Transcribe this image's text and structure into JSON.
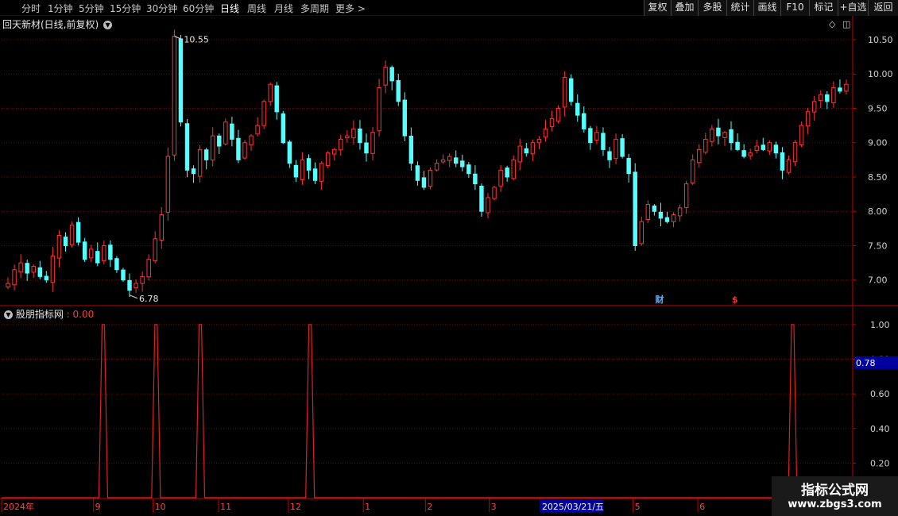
{
  "toolbar": {
    "periods": [
      "分时",
      "1分钟",
      "5分钟",
      "15分钟",
      "30分钟",
      "60分钟",
      "日线",
      "周线",
      "月线",
      "多周期",
      "更多 >"
    ],
    "active_period": "日线",
    "right_buttons": [
      "复权",
      "叠加",
      "多股",
      "统计",
      "画线",
      "F10",
      "标记",
      "+自选",
      "返回"
    ]
  },
  "main_chart": {
    "title": "回天新材(日线,前复权)",
    "high_label": "10.55",
    "low_label": "6.78",
    "markers": [
      {
        "text": "财",
        "color": "#5ab0ff"
      },
      {
        "text": "$",
        "color": "#ff3030"
      }
    ]
  },
  "indicator": {
    "name": "股朋指标网",
    "value": ": 0.00",
    "cursor_value": "0.78"
  },
  "date_axis": {
    "selected_date": "2025/03/21/五"
  },
  "watermark": {
    "title": "指标公式网",
    "url": "www.zbgs3.com"
  },
  "colors": {
    "up": "#ff3232",
    "down": "#54ffff",
    "grid": "#7a0000",
    "axis": "#c00000",
    "indicator_line": "#e02020",
    "highlight_bg": "#0000a0"
  },
  "chart_data": [
    {
      "type": "candlestick",
      "title": "回天新材(日线,前复权)",
      "ylim": [
        6.65,
        10.65
      ],
      "y_ticks": [
        "10.50",
        "10.00",
        "9.50",
        "9.00",
        "8.50",
        "8.00",
        "7.50",
        "7.00"
      ],
      "x_labels": [
        "2024年",
        "9",
        "10",
        "11",
        "12",
        "1",
        "2",
        "3",
        "2025/03/21/五",
        "5",
        "6"
      ],
      "close_path": [
        6.95,
        7.15,
        7.25,
        7.1,
        7.2,
        7.05,
        7.0,
        7.35,
        7.65,
        7.5,
        7.8,
        7.55,
        7.3,
        7.45,
        7.25,
        7.5,
        7.3,
        7.15,
        7.0,
        6.85,
        6.95,
        7.05,
        7.3,
        7.6,
        7.95,
        8.8,
        10.55,
        9.3,
        8.6,
        8.55,
        8.9,
        8.75,
        9.1,
        8.95,
        9.3,
        9.05,
        8.75,
        9.0,
        9.1,
        9.25,
        9.6,
        9.85,
        9.45,
        9.0,
        8.7,
        8.5,
        8.75,
        8.6,
        8.45,
        8.7,
        8.85,
        8.9,
        9.05,
        9.1,
        9.2,
        9.0,
        8.85,
        9.15,
        9.8,
        10.1,
        9.9,
        9.6,
        9.1,
        8.7,
        8.45,
        8.35,
        8.6,
        8.7,
        8.75,
        8.8,
        8.7,
        8.65,
        8.55,
        8.4,
        8.0,
        8.2,
        8.35,
        8.6,
        8.5,
        8.75,
        8.95,
        8.85,
        9.0,
        9.05,
        9.2,
        9.35,
        9.5,
        9.95,
        9.6,
        9.4,
        9.2,
        9.0,
        9.15,
        8.9,
        8.75,
        9.05,
        8.8,
        8.55,
        7.5,
        7.85,
        8.1,
        8.0,
        7.9,
        7.85,
        7.95,
        8.05,
        8.4,
        8.75,
        8.9,
        9.05,
        9.2,
        9.1,
        9.15,
        9.0,
        8.9,
        8.8,
        8.85,
        8.95,
        8.9,
        9.0,
        8.85,
        8.6,
        8.75,
        9.0,
        9.25,
        9.45,
        9.6,
        9.7,
        9.6,
        9.8,
        9.75,
        9.85
      ]
    },
    {
      "type": "line",
      "title": "股朋指标网",
      "ylim": [
        0,
        1.05
      ],
      "y_ticks": [
        "1.00",
        "0.80",
        "0.60",
        "0.40",
        "0.20"
      ],
      "spike_x_fraction": [
        0.119,
        0.181,
        0.233,
        0.362,
        0.929
      ],
      "spike_values": [
        1.0,
        1.0,
        1.0,
        1.0,
        1.0
      ]
    }
  ]
}
